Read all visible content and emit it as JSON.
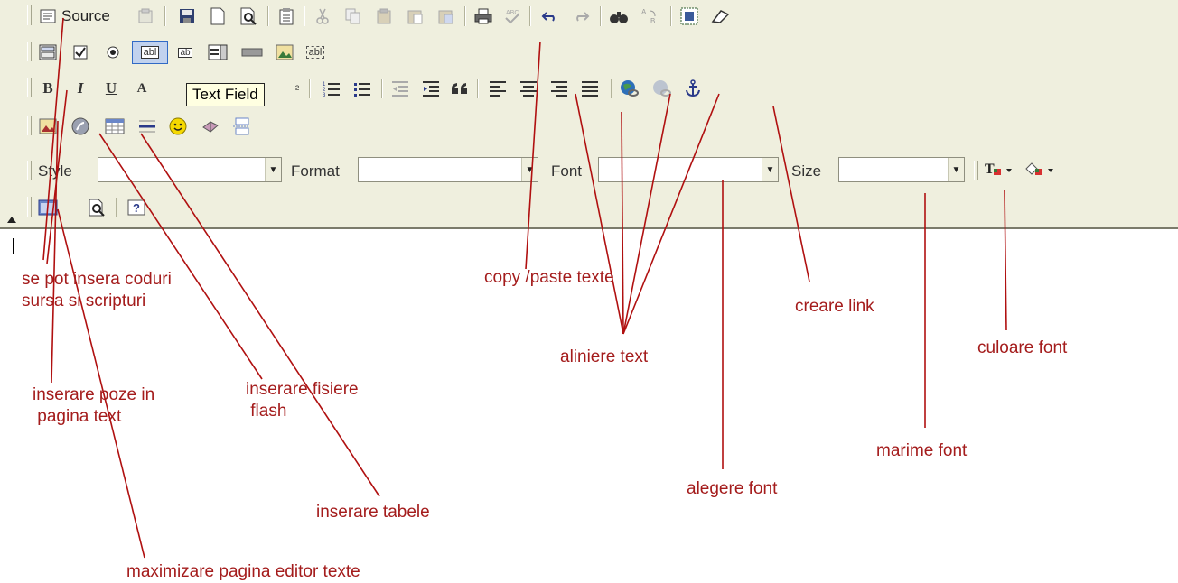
{
  "toolbar": {
    "source_label": "Source",
    "tooltip": "Text Field",
    "bold_label": "B",
    "italic_label": "I",
    "underline_label": "U",
    "strike_label": "A",
    "style_label": "Style",
    "style_value": "",
    "format_label": "Format",
    "format_value": "",
    "font_label": "Font",
    "font_value": "",
    "size_label": "Size",
    "size_value": "",
    "small_field_glyph": "abl",
    "text_field_glyph": "abl",
    "textarea_glyph": "ab",
    "subscript_char": "²"
  },
  "icons": {
    "row1": [
      "source-icon",
      "paste-from-word-icon",
      "save-icon",
      "new-page-icon",
      "preview-icon",
      "templates-icon",
      "cut-icon",
      "copy-icon",
      "paste-icon",
      "paste-text-icon",
      "paste-word-icon",
      "print-icon",
      "spellcheck-icon",
      "undo-icon",
      "redo-icon",
      "find-icon",
      "replace-icon",
      "select-all-icon",
      "remove-format-icon"
    ],
    "row2": [
      "form-icon",
      "checkbox-icon",
      "radio-icon",
      "text-field-icon",
      "textarea-icon",
      "select-field-icon",
      "button-icon",
      "image-button-icon",
      "hidden-field-icon"
    ],
    "row3": [
      "bold-icon",
      "italic-icon",
      "underline-icon",
      "strike-icon",
      "subscript-icon",
      "numbered-list-icon",
      "bulleted-list-icon",
      "outdent-icon",
      "indent-icon",
      "blockquote-icon",
      "align-left-icon",
      "align-center-icon",
      "align-right-icon",
      "justify-icon",
      "link-icon",
      "unlink-icon",
      "anchor-icon"
    ],
    "row4": [
      "image-icon",
      "flash-icon",
      "table-icon",
      "horizontal-rule-icon",
      "smiley-icon",
      "special-char-icon",
      "page-break-icon"
    ],
    "row5": [
      "text-color-icon",
      "background-color-icon"
    ],
    "row6": [
      "maximize-icon",
      "show-blocks-icon",
      "about-icon"
    ]
  },
  "colors": {
    "toolbar_bg": "#efefde",
    "annotation": "#a41c1c",
    "leader_line": "#b01010",
    "highlight": "#c1d2ee"
  },
  "annotations": {
    "source": "se pot insera coduri\nsursa si scripturi",
    "images": "inserare poze in\n pagina text",
    "flash": "inserare fisiere\n flash",
    "tables": "inserare tabele",
    "maximize": "maximizare pagina editor texte",
    "copy_paste": "copy /paste texte",
    "align": "aliniere text",
    "font_choice": "alegere font",
    "link": "creare link",
    "font_size": "marime font",
    "font_color": "culoare font"
  }
}
